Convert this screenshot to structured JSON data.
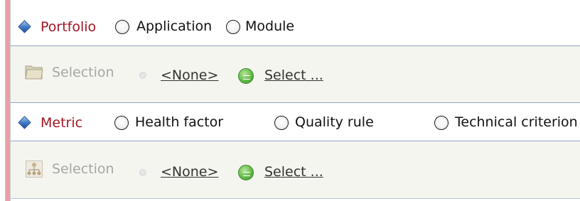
{
  "portfolio": {
    "title": "Portfolio",
    "options": [
      {
        "label": "Application",
        "selected": false
      },
      {
        "label": "Module",
        "selected": false
      }
    ],
    "selection": {
      "label": "Selection",
      "value": "<None>",
      "select_link": "Select ...",
      "icon": "folder-icon"
    }
  },
  "metric": {
    "title": "Metric",
    "options": [
      {
        "label": "Health factor",
        "selected": false
      },
      {
        "label": "Quality rule",
        "selected": false
      },
      {
        "label": "Technical criterion",
        "selected": false
      }
    ],
    "selection": {
      "label": "Selection",
      "value": "<None>",
      "select_link": "Select ...",
      "icon": "hierarchy-icon"
    }
  },
  "colors": {
    "section_title": "#a01623",
    "left_bar": "#e8a0a6",
    "panel_bg": "#f5f5f0",
    "panel_border": "#8fa6c2",
    "select_button": "#63bb4a"
  }
}
